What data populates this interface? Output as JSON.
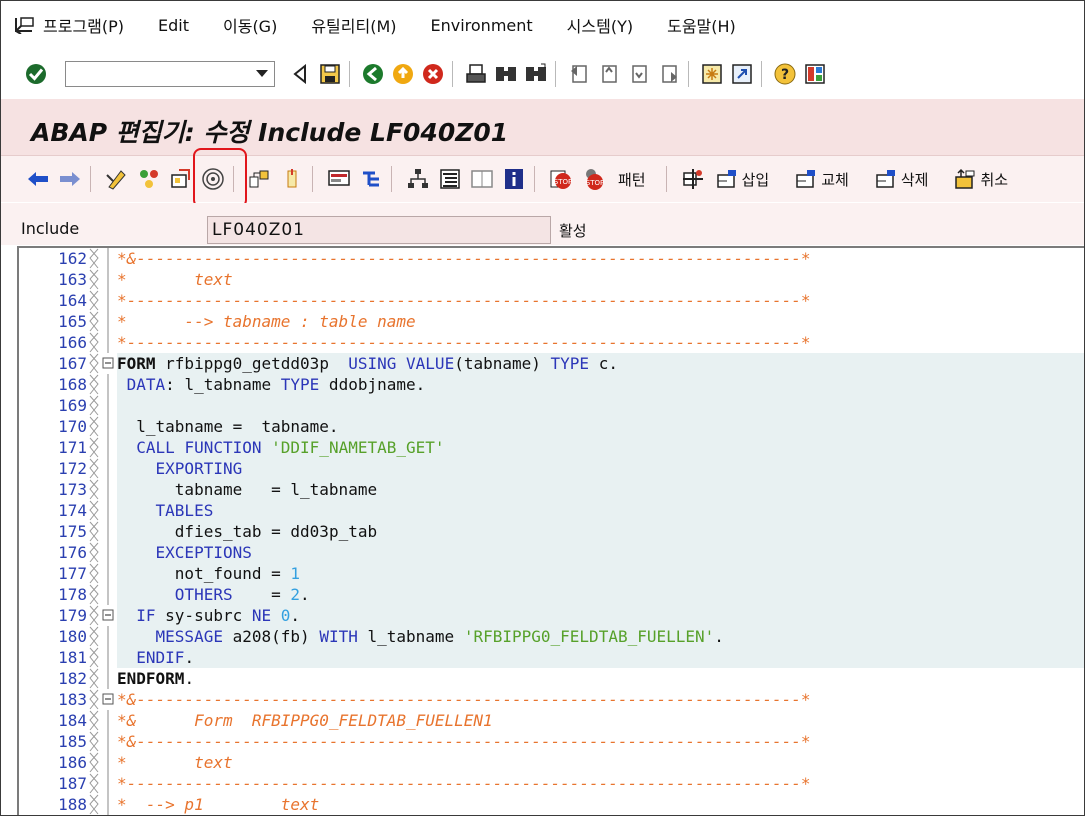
{
  "menubar": {
    "items": [
      "프로그램(P)",
      "Edit",
      "이동(G)",
      "유틸리티(M)",
      "Environment",
      "시스템(Y)",
      "도움말(H)"
    ]
  },
  "stdbar": {
    "command_value": ""
  },
  "title": "ABAP 편집기: 수정 Include LF040Z01",
  "appbar": {
    "pattern_label": "패턴",
    "insert_label": "삽입",
    "replace_label": "교체",
    "delete_label": "삭제",
    "undo_label": "취소"
  },
  "include_row": {
    "label": "Include",
    "value": "LF040Z01",
    "status": "활성"
  },
  "editor": {
    "lines": [
      {
        "num": "162",
        "text": "*&---------------------------------------------------------------------*"
      },
      {
        "num": "163",
        "text": "*       text"
      },
      {
        "num": "164",
        "text": "*----------------------------------------------------------------------*"
      },
      {
        "num": "165",
        "text": "*      --> tabname : table name"
      },
      {
        "num": "166",
        "text": "*----------------------------------------------------------------------*"
      },
      {
        "num": "167",
        "text": "FORM rfbippg0_getdd03p  USING VALUE(tabname) TYPE c."
      },
      {
        "num": "168",
        "text": " DATA: l_tabname TYPE ddobjname."
      },
      {
        "num": "169",
        "text": ""
      },
      {
        "num": "170",
        "text": "  l_tabname =  tabname."
      },
      {
        "num": "171",
        "text": "  CALL FUNCTION 'DDIF_NAMETAB_GET'"
      },
      {
        "num": "172",
        "text": "    EXPORTING"
      },
      {
        "num": "173",
        "text": "      tabname   = l_tabname"
      },
      {
        "num": "174",
        "text": "    TABLES"
      },
      {
        "num": "175",
        "text": "      dfies_tab = dd03p_tab"
      },
      {
        "num": "176",
        "text": "    EXCEPTIONS"
      },
      {
        "num": "177",
        "text": "      not_found = 1"
      },
      {
        "num": "178",
        "text": "      OTHERS    = 2."
      },
      {
        "num": "179",
        "text": "  IF sy-subrc NE 0."
      },
      {
        "num": "180",
        "text": "    MESSAGE a208(fb) WITH l_tabname 'RFBIPPG0_FELDTAB_FUELLEN'."
      },
      {
        "num": "181",
        "text": "  ENDIF."
      },
      {
        "num": "182",
        "text": "ENDFORM."
      },
      {
        "num": "183",
        "text": "*&---------------------------------------------------------------------*"
      },
      {
        "num": "184",
        "text": "*&      Form  RFBIPPG0_FELDTAB_FUELLEN1"
      },
      {
        "num": "185",
        "text": "*&---------------------------------------------------------------------*"
      },
      {
        "num": "186",
        "text": "*       text"
      },
      {
        "num": "187",
        "text": "*----------------------------------------------------------------------*"
      },
      {
        "num": "188",
        "text": "*  --> p1        text"
      }
    ]
  }
}
